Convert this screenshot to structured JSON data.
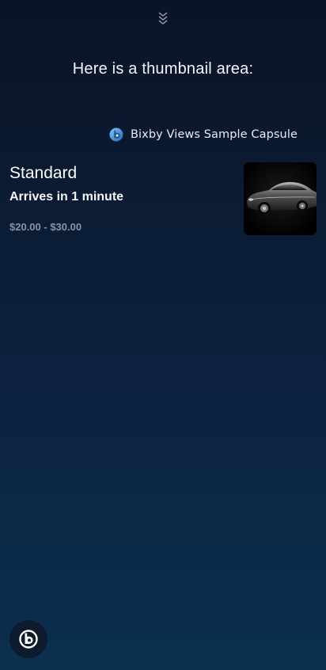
{
  "header": {
    "title": "Here is a thumbnail area:"
  },
  "capsule": {
    "icon": "bixby-logo-icon",
    "name": "Bixby Views Sample Capsule"
  },
  "card": {
    "title": "Standard",
    "subtitle": "Arrives in 1 minute",
    "price": "$20.00 - $30.00",
    "thumbnail": "car-image"
  },
  "controls": {
    "collapse_icon": "double-chevron-down-icon",
    "bixby_button_icon": "bixby-logo-icon"
  },
  "colors": {
    "background_top": "#0b1326",
    "background_bottom": "#0b3050",
    "price_text": "#8a93a3",
    "bixby_button": "#0e1a2d",
    "capsule_icon_light": "#5fb6f0",
    "capsule_icon_dark": "#1f5fbf"
  }
}
